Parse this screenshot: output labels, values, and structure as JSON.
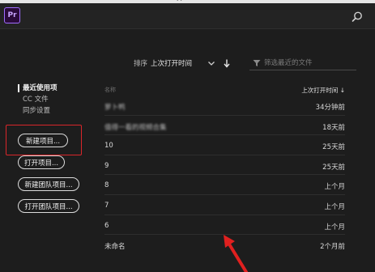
{
  "window": {
    "title": "Pr"
  },
  "app": {
    "logo_text": "Pr"
  },
  "sort": {
    "label": "排序",
    "value": "上次打开时间"
  },
  "filter": {
    "placeholder": "筛选最近的文件"
  },
  "nav": [
    {
      "label": "最近使用项",
      "active": true
    },
    {
      "label": "CC 文件",
      "active": false
    },
    {
      "label": "同步设置",
      "active": false
    }
  ],
  "buttons": {
    "new_project": "新建项目...",
    "open_project": "打开项目...",
    "new_team_project": "新建团队项目...",
    "open_team_project": "打开团队项目..."
  },
  "table": {
    "col_name": "名称",
    "col_time": "上次打开时间",
    "rows": [
      {
        "name": "萝卜鸭",
        "time": "34分钟前"
      },
      {
        "name": "值得一看的视频合集",
        "time": "18天前"
      },
      {
        "name": "10",
        "time": "25天前"
      },
      {
        "name": "9",
        "time": "25天前"
      },
      {
        "name": "8",
        "time": "上个月"
      },
      {
        "name": "7",
        "time": "上个月"
      },
      {
        "name": "6",
        "time": "上个月"
      },
      {
        "name": "未命名",
        "time": "2个月前"
      }
    ]
  },
  "colors": {
    "accent_purple": "#a06cff",
    "highlight_red": "#d9262a",
    "background": "#1d1d1d"
  },
  "icons": [
    "search-icon",
    "chevron-down-icon",
    "arrow-down-icon",
    "filter-icon"
  ]
}
